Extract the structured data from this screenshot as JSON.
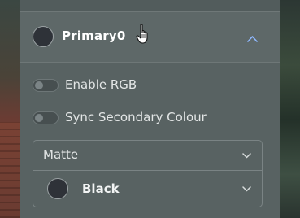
{
  "header": {
    "title": "Primary0",
    "swatch_color": "#2e3238"
  },
  "toggles": [
    {
      "label": "Enable RGB",
      "on": false
    },
    {
      "label": "Sync Secondary Colour",
      "on": false
    }
  ],
  "dropdown": {
    "finish": "Matte",
    "color_name": "Black",
    "color_swatch": "#2e3238"
  },
  "icons": {
    "header_chevron": "chevron-up-icon",
    "dropdown_chevron": "chevron-down-icon",
    "cursor": "hand-pointer-icon"
  },
  "colors": {
    "panel": "#586262",
    "accent_chevron": "#8fb8ff"
  }
}
